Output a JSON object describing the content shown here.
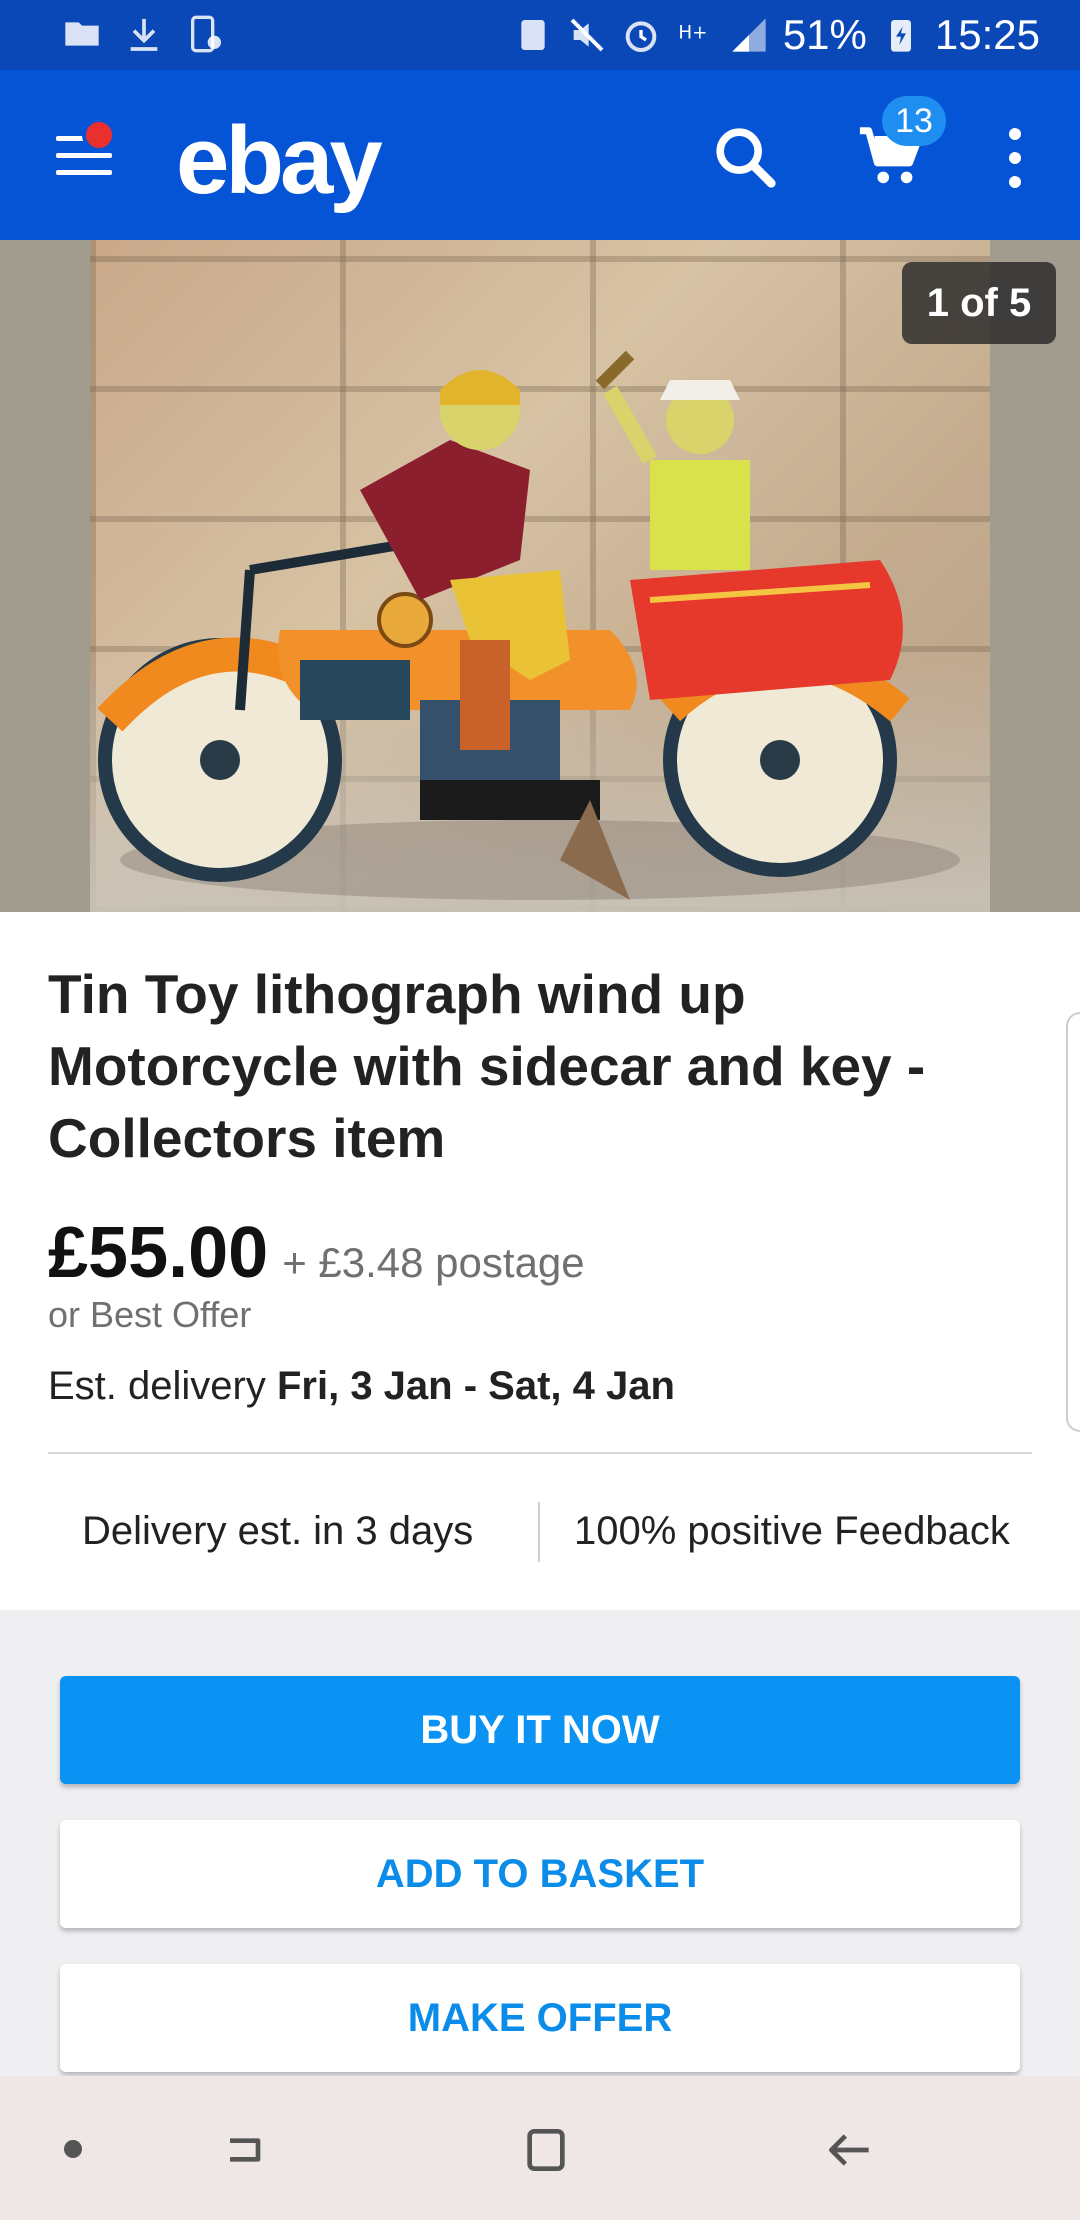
{
  "status_bar": {
    "battery": "51%",
    "time": "15:25"
  },
  "app_bar": {
    "logo": "ebay",
    "cart_count": "13",
    "icons": [
      "menu-icon",
      "search-icon",
      "cart-icon",
      "more-vertical-icon"
    ]
  },
  "gallery": {
    "counter": "1 of 5"
  },
  "item": {
    "title": "Tin Toy lithograph wind up Motorcycle with sidecar and key - Collectors item",
    "price": "£55.00",
    "postage": "+ £3.48 postage",
    "best_offer": "or Best Offer",
    "delivery_label": "Est. delivery",
    "delivery_dates": "Fri, 3 Jan - Sat, 4 Jan",
    "stat_delivery": "Delivery est. in 3 days",
    "stat_feedback": "100% positive Feedback"
  },
  "actions": {
    "buy_now": "BUY IT NOW",
    "add_to_basket": "ADD TO BASKET",
    "make_offer": "MAKE OFFER"
  },
  "colors": {
    "status_bar": "#0a48b8",
    "app_bar": "#0654d6",
    "primary_button": "#0a93f2",
    "accent_text": "#0a8ce8"
  }
}
